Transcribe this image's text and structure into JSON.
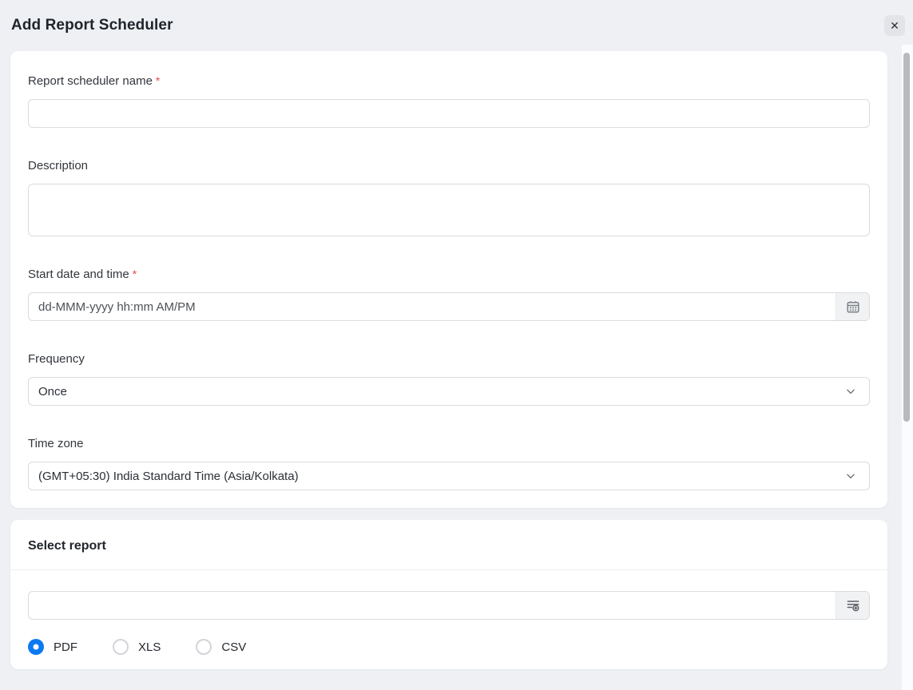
{
  "header": {
    "title": "Add Report Scheduler",
    "close_glyph": "✕"
  },
  "form": {
    "required_marker": "*",
    "name": {
      "label": "Report scheduler name",
      "value": "",
      "required": true
    },
    "description": {
      "label": "Description",
      "value": ""
    },
    "start": {
      "label": "Start date and time",
      "value": "",
      "placeholder": "dd-MMM-yyyy hh:mm AM/PM",
      "required": true
    },
    "frequency": {
      "label": "Frequency",
      "value": "Once"
    },
    "timezone": {
      "label": "Time zone",
      "value": "(GMT+05:30) India Standard Time (Asia/Kolkata)"
    }
  },
  "report": {
    "title": "Select report",
    "search_value": "",
    "formats": [
      {
        "label": "PDF",
        "selected": true
      },
      {
        "label": "XLS",
        "selected": false
      },
      {
        "label": "CSV",
        "selected": false
      }
    ]
  },
  "icons": {
    "close": "✕",
    "calendar": "calendar-grid",
    "chevron_down": "⌄",
    "report_picker": "list-with-plus-circle"
  },
  "colors": {
    "accent_blue": "#0b79f2",
    "required_red": "#e8474b",
    "page_bg": "#eef0f3",
    "card_bg": "#ffffff"
  }
}
